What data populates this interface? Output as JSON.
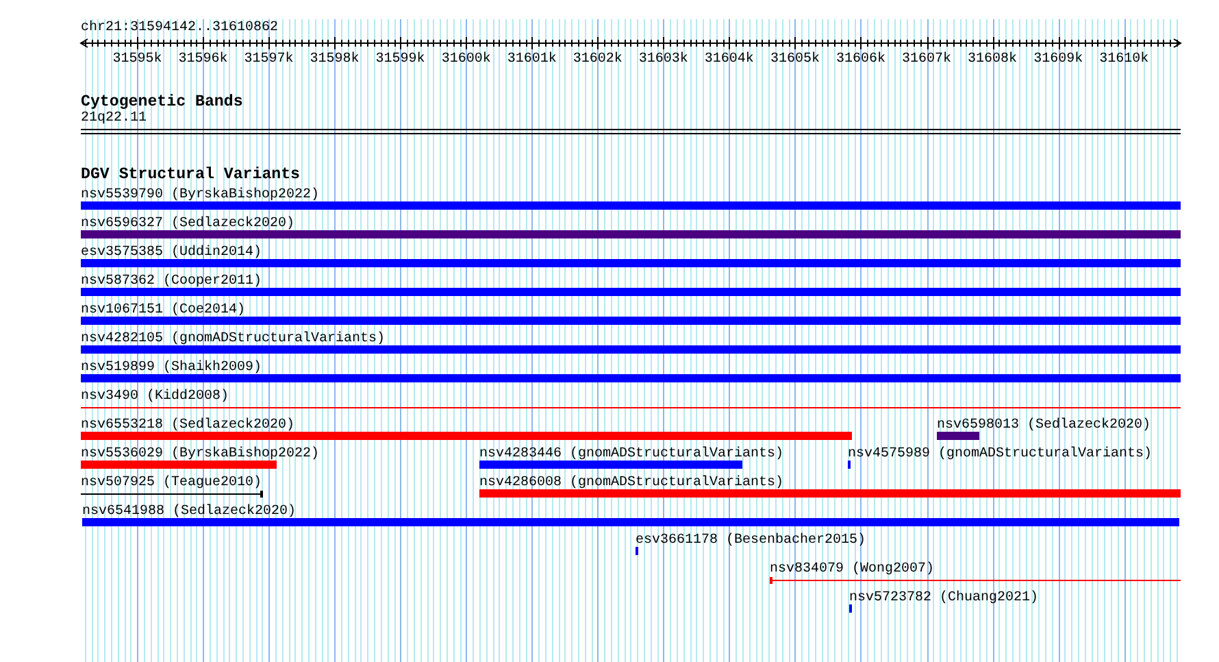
{
  "location": "chr21:31594142..31610862",
  "ruler": {
    "ticks": [
      "31595k",
      "31596k",
      "31597k",
      "31598k",
      "31599k",
      "31600k",
      "31601k",
      "31602k",
      "31603k",
      "31604k",
      "31605k",
      "31606k",
      "31607k",
      "31608k",
      "31609k",
      "31610k"
    ]
  },
  "tracks": [
    {
      "title": "Cytogenetic Bands",
      "kind": "bands",
      "bands": [
        "21q22.11"
      ]
    },
    {
      "title": "DGV Structural Variants",
      "kind": "variants",
      "features": [
        {
          "label": "nsv5539790 (ByrskaBishop2022)",
          "kind": "bar",
          "color": "#0000ff"
        },
        {
          "label": "nsv6596327 (Sedlazeck2020)",
          "kind": "bar",
          "color": "#4b0082"
        },
        {
          "label": "esv3575385 (Uddin2014)",
          "kind": "bar",
          "color": "#0000ff"
        },
        {
          "label": "nsv587362 (Cooper2011)",
          "kind": "bar",
          "color": "#0000ff"
        },
        {
          "label": "nsv1067151 (Coe2014)",
          "kind": "bar",
          "color": "#0000ff"
        },
        {
          "label": "nsv4282105 (gnomADStructuralVariants)",
          "kind": "bar",
          "color": "#0000ff"
        },
        {
          "label": "nsv519899 (Shaikh2009)",
          "kind": "bar",
          "color": "#0000ff"
        },
        {
          "label": "nsv3490 (Kidd2008)",
          "kind": "span",
          "color": "#ff0000"
        },
        {
          "label": "nsv6553218 (Sedlazeck2020)",
          "kind": "bar",
          "color": "#ff0000"
        },
        {
          "label": "nsv6598013 (Sedlazeck2020)",
          "kind": "bar",
          "color": "#4b0082"
        },
        {
          "label": "nsv5536029 (ByrskaBishop2022)",
          "kind": "bar",
          "color": "#ff0000"
        },
        {
          "label": "nsv4283446 (gnomADStructuralVariants)",
          "kind": "bar",
          "color": "#0000ff"
        },
        {
          "label": "nsv4575989 (gnomADStructuralVariants)",
          "kind": "bar",
          "color": "#0000ff"
        },
        {
          "label": "nsv507925 (Teague2010)",
          "kind": "span",
          "color": "#000000"
        },
        {
          "label": "nsv4286008 (gnomADStructuralVariants)",
          "kind": "bar",
          "color": "#ff0000"
        },
        {
          "label": "nsv6541988 (Sedlazeck2020)",
          "kind": "bar",
          "color": "#0000ff"
        },
        {
          "label": "esv3661178 (Besenbacher2015)",
          "kind": "bar",
          "color": "#0000ff"
        },
        {
          "label": "nsv834079 (Wong2007)",
          "kind": "span",
          "color": "#ff0000"
        },
        {
          "label": "nsv5723782 (Chuang2021)",
          "kind": "bar",
          "color": "#0000ff"
        }
      ]
    }
  ]
}
